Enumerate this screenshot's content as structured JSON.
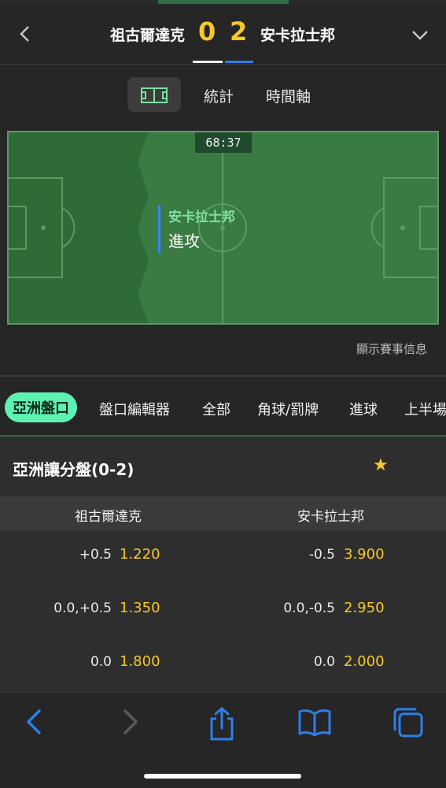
{
  "header": {
    "home_team": "祖古爾達克",
    "away_team": "安卡拉士邦",
    "home_score": "0",
    "away_score": "2",
    "back_icon": "chevron-left-icon",
    "expand_icon": "chevron-down-icon"
  },
  "subtabs": {
    "pitch_icon": "pitch-icon",
    "stats": "統計",
    "timeline": "時間軸"
  },
  "field": {
    "clock": "68:37",
    "attacking_team": "安卡拉士邦",
    "action": "進攻"
  },
  "match_info_link": "顯示賽事信息",
  "categories": [
    "亞洲盤口",
    "盤口編輯器",
    "全部",
    "角球/罰牌",
    "進球",
    "上半場"
  ],
  "market": {
    "title": "亞洲讓分盤(0-2)",
    "favorite_icon": "star-icon",
    "col_home": "祖古爾達克",
    "col_away": "安卡拉士邦",
    "rows": [
      {
        "home_line": "+0.5",
        "home_odds": "1.220",
        "away_line": "-0.5",
        "away_odds": "3.900"
      },
      {
        "home_line": "0.0,+0.5",
        "home_odds": "1.350",
        "away_line": "0.0,-0.5",
        "away_odds": "2.950"
      },
      {
        "home_line": "0.0",
        "home_odds": "1.800",
        "away_line": "0.0",
        "away_odds": "2.000"
      }
    ]
  },
  "colors": {
    "accent_yellow": "#f6c928",
    "accent_green": "#5ef2b2",
    "pitch_green": "#3a7a43",
    "away_blue": "#2f7ee8",
    "toolbar_blue": "#2f7ee8"
  }
}
